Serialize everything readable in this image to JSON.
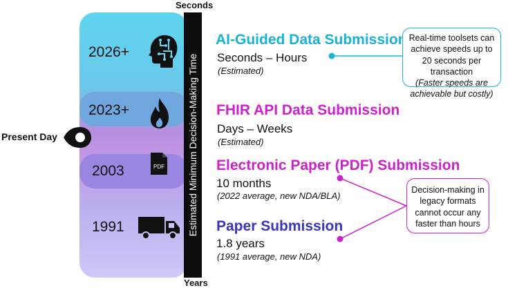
{
  "axis": {
    "top_label": "Seconds",
    "bottom_label": "Years",
    "title": "Estimated Minimum Decision-Making Time"
  },
  "present_marker": {
    "label": "Present Day"
  },
  "eras": [
    {
      "year": "2026+",
      "title": "AI-Guided Data Submission",
      "range": "Seconds – Hours",
      "note": "(Estimated)",
      "title_color": "#17b2d4",
      "band_color": "#5dd3ec",
      "icon": "brain-circuit-icon"
    },
    {
      "year": "2023+",
      "title": "FHIR API Data Submission",
      "range": "Days – Weeks",
      "note": "(Estimated)",
      "title_color": "#cc22cc",
      "band_color": "#6ca4dc",
      "icon": "flame-icon"
    },
    {
      "year": "2003",
      "title": "Electronic Paper (PDF) Submission",
      "range": "10 months",
      "note": "(2022 average, new NDA/BLA)",
      "title_color": "#cc22cc",
      "band_color": "#9b86e0",
      "icon": "pdf-file-icon"
    },
    {
      "year": "1991",
      "title": "Paper Submission",
      "range": "1.8 years",
      "note": "(1991 average, new NDA)",
      "title_color": "#3b35b8",
      "band_color": "#b7b2ef",
      "icon": "truck-icon"
    }
  ],
  "callouts": {
    "top": {
      "text": "Real-time toolsets can achieve speeds up to 20 seconds per transaction",
      "italic": "(Faster speeds are achievable but costly)",
      "border_color": "#1fb3d3"
    },
    "bottom": {
      "text": "Decision-making in legacy formats cannot occur any faster than hours",
      "border_color": "#cc22cc"
    }
  }
}
